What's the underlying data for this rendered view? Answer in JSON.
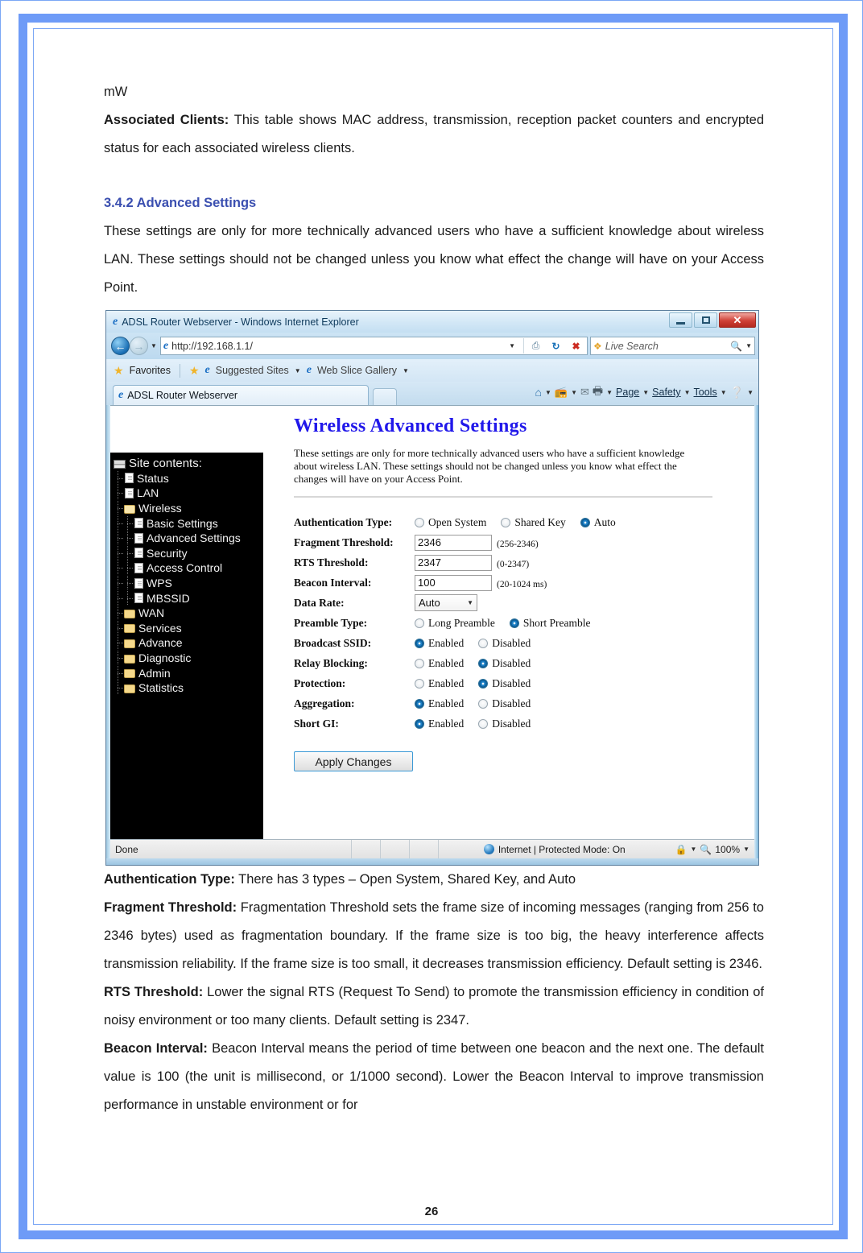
{
  "document": {
    "page_number": "26",
    "intro_line": "mW",
    "paragraphs": [
      {
        "lead": "Associated Clients:",
        "text": " This table shows MAC address, transmission, reception packet counters and encrypted status for each associated wireless clients."
      }
    ],
    "section_heading": "3.4.2 Advanced Settings",
    "section_intro": "These settings are only for more technically advanced users who have a sufficient knowledge about wireless LAN. These settings should not be changed unless you know what effect the change will have on your Access Point.",
    "after_figure": [
      {
        "lead": "Authentication Type:",
        "text": " There has 3 types – Open System, Shared Key, and Auto"
      },
      {
        "lead": "Fragment Threshold:",
        "text": " Fragmentation Threshold sets the frame size of incoming messages (ranging from 256 to 2346 bytes) used as fragmentation boundary. If the frame size is too big, the heavy interference affects transmission reliability. If the frame size is too small, it decreases transmission efficiency. Default setting is 2346."
      },
      {
        "lead": "RTS Threshold:",
        "text": " Lower the signal RTS (Request To Send) to promote the transmission efficiency in condition of noisy environment or too many clients. Default setting is 2347."
      },
      {
        "lead": "Beacon Interval:",
        "text": " Beacon Interval means the period of time between one beacon and the next one. The default value is 100 (the unit is millisecond, or 1/1000 second). Lower the Beacon Interval to improve transmission performance in unstable environment or for"
      }
    ]
  },
  "browser": {
    "window_title": "ADSL Router Webserver - Windows Internet Explorer",
    "window_buttons": {
      "minimize": "minimize-button",
      "maximize": "maximize-button",
      "close": "✕"
    },
    "address": {
      "url": "http://192.168.1.1/",
      "protocol": "http://",
      "host": "192.168.1.1/"
    },
    "search": {
      "placeholder": "Live Search"
    },
    "favorites_bar": {
      "favorites_label": "Favorites",
      "suggested_sites": "Suggested Sites",
      "web_slice_gallery": "Web Slice Gallery"
    },
    "tab": {
      "title": "ADSL Router Webserver"
    },
    "command_bar": {
      "page": "Page",
      "safety": "Safety",
      "tools": "Tools"
    },
    "status_bar": {
      "status": "Done",
      "zone": "Internet | Protected Mode: On",
      "zoom": "100%"
    }
  },
  "router_page": {
    "sidebar": {
      "root_label": "Site contents:",
      "items": [
        {
          "label": "Status",
          "icon": "document-icon",
          "depth": 1
        },
        {
          "label": "LAN",
          "icon": "document-icon",
          "depth": 1
        },
        {
          "label": "Wireless",
          "icon": "folder-open-icon",
          "depth": 1
        },
        {
          "label": "Basic Settings",
          "icon": "document-icon",
          "depth": 2
        },
        {
          "label": "Advanced Settings",
          "icon": "document-icon",
          "depth": 2
        },
        {
          "label": "Security",
          "icon": "document-icon",
          "depth": 2
        },
        {
          "label": "Access Control",
          "icon": "document-icon",
          "depth": 2
        },
        {
          "label": "WPS",
          "icon": "document-icon",
          "depth": 2
        },
        {
          "label": "MBSSID",
          "icon": "document-icon",
          "depth": 2
        },
        {
          "label": "WAN",
          "icon": "folder-icon",
          "depth": 1
        },
        {
          "label": "Services",
          "icon": "folder-icon",
          "depth": 1
        },
        {
          "label": "Advance",
          "icon": "folder-icon",
          "depth": 1
        },
        {
          "label": "Diagnostic",
          "icon": "folder-icon",
          "depth": 1
        },
        {
          "label": "Admin",
          "icon": "folder-icon",
          "depth": 1
        },
        {
          "label": "Statistics",
          "icon": "folder-icon",
          "depth": 1
        }
      ]
    },
    "heading": "Wireless Advanced Settings",
    "description": "These settings are only for more technically advanced users who have a sufficient knowledge about wireless LAN. These settings should not be changed unless you know what effect the changes will have on your Access Point.",
    "form": {
      "auth_type": {
        "label": "Authentication Type:",
        "options": [
          "Open System",
          "Shared Key",
          "Auto"
        ],
        "selected": "Auto"
      },
      "fragment_threshold": {
        "label": "Fragment Threshold:",
        "value": "2346",
        "hint": "(256-2346)"
      },
      "rts_threshold": {
        "label": "RTS Threshold:",
        "value": "2347",
        "hint": "(0-2347)"
      },
      "beacon_interval": {
        "label": "Beacon Interval:",
        "value": "100",
        "hint": "(20-1024 ms)"
      },
      "data_rate": {
        "label": "Data Rate:",
        "value": "Auto"
      },
      "preamble_type": {
        "label": "Preamble Type:",
        "options": [
          "Long Preamble",
          "Short Preamble"
        ],
        "selected": "Short Preamble"
      },
      "broadcast_ssid": {
        "label": "Broadcast SSID:",
        "options": [
          "Enabled",
          "Disabled"
        ],
        "selected": "Enabled"
      },
      "relay_blocking": {
        "label": "Relay Blocking:",
        "options": [
          "Enabled",
          "Disabled"
        ],
        "selected": "Disabled"
      },
      "protection": {
        "label": "Protection:",
        "options": [
          "Enabled",
          "Disabled"
        ],
        "selected": "Disabled"
      },
      "aggregation": {
        "label": "Aggregation:",
        "options": [
          "Enabled",
          "Disabled"
        ],
        "selected": "Enabled"
      },
      "short_gi": {
        "label": "Short GI:",
        "options": [
          "Enabled",
          "Disabled"
        ],
        "selected": "Enabled"
      },
      "apply_button": "Apply Changes"
    }
  },
  "colors": {
    "page_border_blue": "#6e9bf7",
    "heading_purple": "#3b4fb0",
    "router_heading_blue": "#2118ea",
    "sidebar_black": "#000000",
    "radio_on_blue": "#1b7fc4"
  }
}
